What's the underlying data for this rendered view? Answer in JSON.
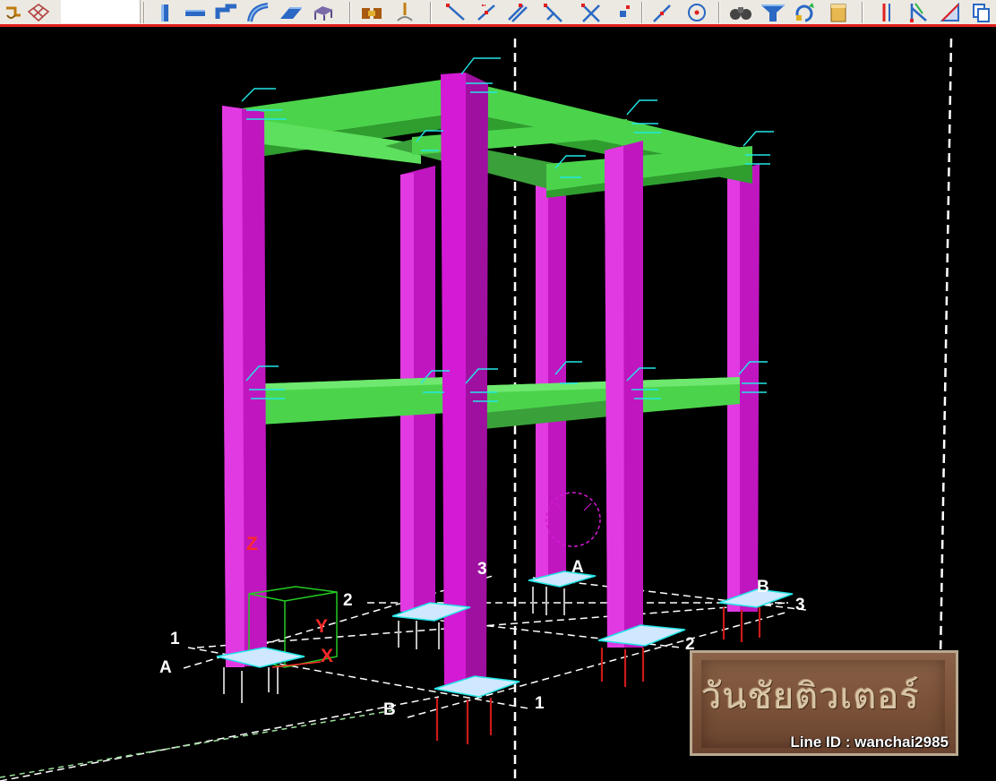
{
  "toolbar": {
    "tools": [
      {
        "icon": "plan-icon",
        "group": "view"
      },
      {
        "icon": "lattice-icon",
        "group": "view"
      },
      {
        "icon": "column-icon",
        "group": "members"
      },
      {
        "icon": "beam-icon",
        "group": "members"
      },
      {
        "icon": "polybeam-icon",
        "group": "members"
      },
      {
        "icon": "curved-beam-icon",
        "group": "members"
      },
      {
        "icon": "plate-icon",
        "group": "members"
      },
      {
        "icon": "bench-icon",
        "group": "members"
      },
      {
        "icon": "bolt-icon",
        "group": "members"
      },
      {
        "icon": "weld-icon",
        "group": "members"
      },
      {
        "icon": "snap-end-icon",
        "group": "snap"
      },
      {
        "icon": "snap-midpoint-icon",
        "group": "snap"
      },
      {
        "icon": "snap-line-icon",
        "group": "snap"
      },
      {
        "icon": "snap-perpendicular-icon",
        "group": "snap"
      },
      {
        "icon": "snap-intersection-icon",
        "group": "snap"
      },
      {
        "icon": "snap-point-icon",
        "group": "snap"
      },
      {
        "icon": "snap-nearest-icon",
        "group": "snap"
      },
      {
        "icon": "snap-center-icon",
        "group": "snap"
      },
      {
        "icon": "binoculars-icon",
        "group": "inquire"
      },
      {
        "icon": "filter-icon",
        "group": "inquire"
      },
      {
        "icon": "rotate-icon",
        "group": "inquire"
      },
      {
        "icon": "box-icon",
        "group": "inquire"
      },
      {
        "icon": "measure-icon",
        "group": "measure"
      },
      {
        "icon": "measure-angle-icon",
        "group": "measure"
      },
      {
        "icon": "measure-slope-icon",
        "group": "measure"
      },
      {
        "icon": "copy-icon",
        "group": "measure"
      }
    ]
  },
  "viewport": {
    "grid_labels": {
      "a_left": "A",
      "one_left": "1",
      "two_top": "2",
      "three_top": "3",
      "a_back": "A",
      "b_right": "B",
      "three_right": "3",
      "two_right": "2",
      "one_front": "1",
      "b_front": "B"
    },
    "axis_labels": {
      "z": "Z",
      "y": "Y",
      "x": "X"
    },
    "colors": {
      "column": "#d41ad4",
      "beam": "#4bd44b",
      "connection": "#22e6e6",
      "rebar": "#cc1a1a",
      "grid_line": "#ffffff",
      "work_area": "#22cc22"
    }
  },
  "watermark": {
    "title": "วันชัยติวเตอร์",
    "line_id": "Line ID : wanchai2985"
  }
}
